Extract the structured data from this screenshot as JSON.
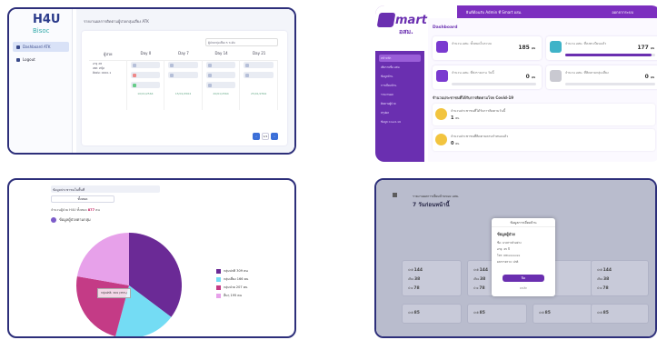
{
  "panel1": {
    "logo": "H4U",
    "logo_sub": "Bisoc",
    "nav": [
      {
        "label": "Dashboard ATK",
        "active": true
      },
      {
        "label": "Logout",
        "active": false
      }
    ],
    "card_title": "รายงานผลการติดตามผู้ป่วยกลุ่มเสี่ยง ATK",
    "filter_label": "ผู้ป่วยกลุ่มเสี่ยง 5 ระดับ",
    "columns": [
      "ผู้ป่วย",
      "Day 0",
      "Day 7",
      "Day 14",
      "Day 21"
    ],
    "patient_lines": [
      "อายุ 28",
      "เพศ: หญิง",
      "ติดต่อ: 0000-1"
    ],
    "dates": [
      "10/01/2564",
      "15/01/2564",
      "20/01/2564",
      "25/01/2564"
    ],
    "page": "1/1"
  },
  "panel2": {
    "topbar": "ยินดีต้อนรับ Admin ที่ Smart อสม.",
    "topbar_right": "ออกจากระบบ",
    "logo_word": "mart",
    "logo_sub": "อสม.",
    "nav": [
      "หน้าหลัก",
      "เพิ่มรายชื่อ อสม.",
      "ข้อมูลบ้าน",
      "การเยี่ยมบ้าน",
      "รายงานผล",
      "ติดตามผู้ป่วย",
      "สรุปผล",
      "ข้อมูล Covid-19"
    ],
    "section": "Dashboard",
    "stats": [
      {
        "label": "จำนวน อสม. ทั้งหมดในระบบ",
        "value": "185",
        "unit": "คน",
        "progress": 1.0
      },
      {
        "label": "จำนวน อสม. ที่ลงทะเบียนแล้ว",
        "value": "177",
        "unit": "คน",
        "progress": 0.96
      },
      {
        "label": "จำนวน อสม. ที่ส่งรายงาน วันนี้",
        "value": "0",
        "unit": "คน",
        "progress": 0.0
      },
      {
        "label": "จำนวน อสม. ที่ติดตามกลุ่มเสี่ยง",
        "value": "0",
        "unit": "คน",
        "progress": 0.0
      }
    ],
    "covid_heading": "จำนวนประชาชนที่ได้รับการติดตามโรค Covid-19",
    "covid": [
      {
        "label": "จำนวนประชาชนที่ได้รับการติดตามวันนี้",
        "value": "1",
        "unit": "คน"
      },
      {
        "label": "จำนวนประชาชนที่ติดตามครบกำหนดแล้ว",
        "value": "0",
        "unit": "คน"
      }
    ]
  },
  "panel3": {
    "header": "ข้อมูลประชาชนในพื้นที่",
    "select": "ทั้งหมด",
    "total_label": "จำนวนผู้ป่วย H4U ทั้งหมด",
    "total_value": "877",
    "total_unit": "คน",
    "subtitle": "ข้อมูลผู้ป่วยตามกลุ่ม",
    "tooltip": "กลุ่มปกติ: 309 (35%)",
    "chart_data": {
      "type": "pie",
      "categories": [
        "กลุ่มปกติ",
        "กลุ่มเสี่ยง",
        "กลุ่มป่วย",
        "อื่นๆ"
      ],
      "values": [
        309,
        166,
        207,
        195
      ],
      "colors": [
        "#6b2a96",
        "#74dcf4",
        "#c43b86",
        "#e7a1ea"
      ]
    }
  },
  "panel4": {
    "title": "รายงานผลการเยี่ยมบ้านของ อสม.",
    "big": "7 วันก่อนหน้านี้",
    "modal_header": "ข้อมูลการเยี่ยมบ้าน",
    "modal_title": "ข้อมูลผู้ป่วย",
    "modal_rows": [
      "ชื่อ: นางสาวตัวอย่าง",
      "อายุ: 45 ปี",
      "โทร: 081xxxxxxx",
      "ผลการตรวจ: ปกติ"
    ],
    "modal_button": "ปิด",
    "modal_link": "ยกเลิก",
    "cards": [
      {
        "rows": [
          [
            "ปกติ",
            "144"
          ],
          [
            "เสี่ยง",
            "38"
          ],
          [
            "ป่วย",
            "78"
          ]
        ]
      },
      {
        "rows": [
          [
            "ปกติ",
            "144"
          ],
          [
            "เสี่ยง",
            "38"
          ],
          [
            "ป่วย",
            "78"
          ]
        ]
      },
      {
        "rows": [
          [
            "ปกติ",
            "144"
          ],
          [
            "เสี่ยง",
            "38"
          ],
          [
            "ป่วย",
            "78"
          ]
        ]
      },
      {
        "rows": [
          [
            "ปกติ",
            "144"
          ],
          [
            "เสี่ยง",
            "38"
          ],
          [
            "ป่วย",
            "78"
          ]
        ]
      }
    ],
    "bottom": [
      {
        "label": "ปกติ",
        "value": "85"
      },
      {
        "label": "ปกติ",
        "value": "85"
      },
      {
        "label": "ปกติ",
        "value": "85"
      },
      {
        "label": "ปกติ",
        "value": "85"
      }
    ]
  }
}
